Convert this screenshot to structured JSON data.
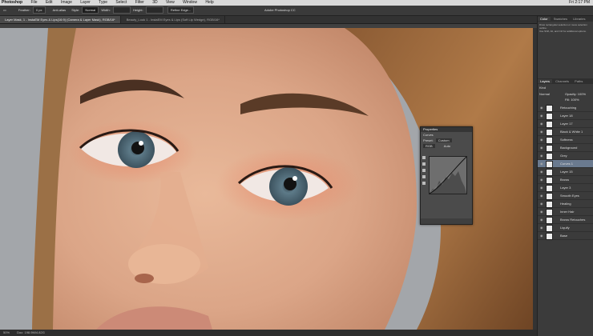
{
  "app": {
    "name": "Photoshop",
    "window_title": "Adobe Photoshop CC",
    "clock": "Fri 2:17 PM"
  },
  "menubar": [
    "Photoshop",
    "File",
    "Edit",
    "Image",
    "Layer",
    "Type",
    "Select",
    "Filter",
    "3D",
    "View",
    "Window",
    "Help"
  ],
  "options": {
    "feather_label": "Feather:",
    "feather_value": "0 px",
    "antialias": "Anti-alias",
    "style_label": "Style:",
    "style_value": "Normal",
    "width_label": "Width:",
    "height_label": "Height:",
    "refine": "Refine Edge..."
  },
  "tabs": [
    {
      "label": "Layer Mask, 1 - InstaEM Eyes & Lips(16:9) (Camera & Layer Mask), RGB/16*",
      "active": true
    },
    {
      "label": "Beauty_Look 1 - InstaEM Eyes & Lips (Soft Lip Wedge), RGB/16*",
      "active": false
    }
  ],
  "status": {
    "zoom": "50%",
    "doc": "Doc: 198.9M/4.82G"
  },
  "right_panel": {
    "top_tabs": [
      "Color",
      "Swatches",
      "Libraries"
    ],
    "info_lines": [
      "Draw rectangular selection or move selection outline.",
      "Use Shift, Alt, and Ctrl for additional options."
    ],
    "layer_tabs": [
      "Layers",
      "Channels",
      "Paths"
    ],
    "kind": "Kind",
    "blend": "Normal",
    "opacity": "Opacity: 100%",
    "fill": "Fill: 100%",
    "layers": [
      {
        "name": "Retouching",
        "selected": false
      },
      {
        "name": "Layer 18",
        "selected": false
      },
      {
        "name": "Layer 17",
        "selected": false
      },
      {
        "name": "Black & White 1",
        "selected": false
      },
      {
        "name": "Softness",
        "selected": false
      },
      {
        "name": "Background",
        "selected": false
      },
      {
        "name": "Grey",
        "selected": false
      },
      {
        "name": "Curves 1",
        "selected": true
      },
      {
        "name": "Layer 15",
        "selected": false
      },
      {
        "name": "Brows",
        "selected": false
      },
      {
        "name": "Layer 3",
        "selected": false
      },
      {
        "name": "Smooth Eyes",
        "selected": false
      },
      {
        "name": "Healing",
        "selected": false
      },
      {
        "name": "Inner Hair",
        "selected": false
      },
      {
        "name": "Brows Retouches",
        "selected": false
      },
      {
        "name": "Liquify",
        "selected": false
      },
      {
        "name": "Base",
        "selected": false
      }
    ]
  },
  "properties": {
    "tab": "Properties",
    "title": "Curves",
    "preset_label": "Preset:",
    "preset_value": "Custom",
    "channel": "RGB",
    "auto": "Auto"
  }
}
